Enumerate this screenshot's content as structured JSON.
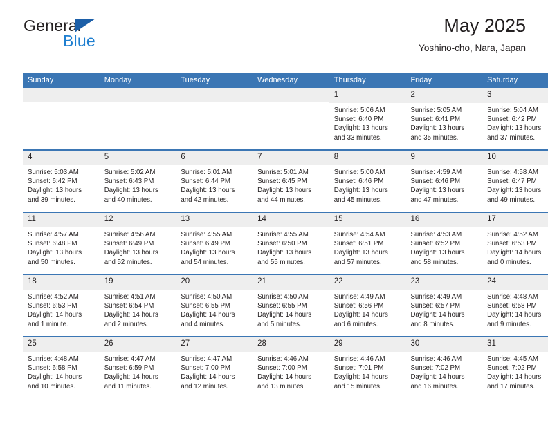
{
  "brand": {
    "name_part1": "General",
    "name_part2": "Blue",
    "flag_icon": "triangle-flag-icon"
  },
  "header": {
    "title": "May 2025",
    "location": "Yoshino-cho, Nara, Japan"
  },
  "colors": {
    "header_blue": "#3b76b4",
    "brand_blue": "#1f7fd0",
    "daynum_gray": "#eeeeee",
    "text": "#231f20"
  },
  "weekday_headers": [
    "Sunday",
    "Monday",
    "Tuesday",
    "Wednesday",
    "Thursday",
    "Friday",
    "Saturday"
  ],
  "labels": {
    "sunrise_prefix": "Sunrise:",
    "sunset_prefix": "Sunset:",
    "daylight_prefix": "Daylight:"
  },
  "weeks": [
    [
      {
        "day": "",
        "sunrise": "",
        "sunset": "",
        "daylight_line1": "",
        "daylight_line2": ""
      },
      {
        "day": "",
        "sunrise": "",
        "sunset": "",
        "daylight_line1": "",
        "daylight_line2": ""
      },
      {
        "day": "",
        "sunrise": "",
        "sunset": "",
        "daylight_line1": "",
        "daylight_line2": ""
      },
      {
        "day": "",
        "sunrise": "",
        "sunset": "",
        "daylight_line1": "",
        "daylight_line2": ""
      },
      {
        "day": "1",
        "sunrise": "Sunrise: 5:06 AM",
        "sunset": "Sunset: 6:40 PM",
        "daylight_line1": "Daylight: 13 hours",
        "daylight_line2": "and 33 minutes."
      },
      {
        "day": "2",
        "sunrise": "Sunrise: 5:05 AM",
        "sunset": "Sunset: 6:41 PM",
        "daylight_line1": "Daylight: 13 hours",
        "daylight_line2": "and 35 minutes."
      },
      {
        "day": "3",
        "sunrise": "Sunrise: 5:04 AM",
        "sunset": "Sunset: 6:42 PM",
        "daylight_line1": "Daylight: 13 hours",
        "daylight_line2": "and 37 minutes."
      }
    ],
    [
      {
        "day": "4",
        "sunrise": "Sunrise: 5:03 AM",
        "sunset": "Sunset: 6:42 PM",
        "daylight_line1": "Daylight: 13 hours",
        "daylight_line2": "and 39 minutes."
      },
      {
        "day": "5",
        "sunrise": "Sunrise: 5:02 AM",
        "sunset": "Sunset: 6:43 PM",
        "daylight_line1": "Daylight: 13 hours",
        "daylight_line2": "and 40 minutes."
      },
      {
        "day": "6",
        "sunrise": "Sunrise: 5:01 AM",
        "sunset": "Sunset: 6:44 PM",
        "daylight_line1": "Daylight: 13 hours",
        "daylight_line2": "and 42 minutes."
      },
      {
        "day": "7",
        "sunrise": "Sunrise: 5:01 AM",
        "sunset": "Sunset: 6:45 PM",
        "daylight_line1": "Daylight: 13 hours",
        "daylight_line2": "and 44 minutes."
      },
      {
        "day": "8",
        "sunrise": "Sunrise: 5:00 AM",
        "sunset": "Sunset: 6:46 PM",
        "daylight_line1": "Daylight: 13 hours",
        "daylight_line2": "and 45 minutes."
      },
      {
        "day": "9",
        "sunrise": "Sunrise: 4:59 AM",
        "sunset": "Sunset: 6:46 PM",
        "daylight_line1": "Daylight: 13 hours",
        "daylight_line2": "and 47 minutes."
      },
      {
        "day": "10",
        "sunrise": "Sunrise: 4:58 AM",
        "sunset": "Sunset: 6:47 PM",
        "daylight_line1": "Daylight: 13 hours",
        "daylight_line2": "and 49 minutes."
      }
    ],
    [
      {
        "day": "11",
        "sunrise": "Sunrise: 4:57 AM",
        "sunset": "Sunset: 6:48 PM",
        "daylight_line1": "Daylight: 13 hours",
        "daylight_line2": "and 50 minutes."
      },
      {
        "day": "12",
        "sunrise": "Sunrise: 4:56 AM",
        "sunset": "Sunset: 6:49 PM",
        "daylight_line1": "Daylight: 13 hours",
        "daylight_line2": "and 52 minutes."
      },
      {
        "day": "13",
        "sunrise": "Sunrise: 4:55 AM",
        "sunset": "Sunset: 6:49 PM",
        "daylight_line1": "Daylight: 13 hours",
        "daylight_line2": "and 54 minutes."
      },
      {
        "day": "14",
        "sunrise": "Sunrise: 4:55 AM",
        "sunset": "Sunset: 6:50 PM",
        "daylight_line1": "Daylight: 13 hours",
        "daylight_line2": "and 55 minutes."
      },
      {
        "day": "15",
        "sunrise": "Sunrise: 4:54 AM",
        "sunset": "Sunset: 6:51 PM",
        "daylight_line1": "Daylight: 13 hours",
        "daylight_line2": "and 57 minutes."
      },
      {
        "day": "16",
        "sunrise": "Sunrise: 4:53 AM",
        "sunset": "Sunset: 6:52 PM",
        "daylight_line1": "Daylight: 13 hours",
        "daylight_line2": "and 58 minutes."
      },
      {
        "day": "17",
        "sunrise": "Sunrise: 4:52 AM",
        "sunset": "Sunset: 6:53 PM",
        "daylight_line1": "Daylight: 14 hours",
        "daylight_line2": "and 0 minutes."
      }
    ],
    [
      {
        "day": "18",
        "sunrise": "Sunrise: 4:52 AM",
        "sunset": "Sunset: 6:53 PM",
        "daylight_line1": "Daylight: 14 hours",
        "daylight_line2": "and 1 minute."
      },
      {
        "day": "19",
        "sunrise": "Sunrise: 4:51 AM",
        "sunset": "Sunset: 6:54 PM",
        "daylight_line1": "Daylight: 14 hours",
        "daylight_line2": "and 2 minutes."
      },
      {
        "day": "20",
        "sunrise": "Sunrise: 4:50 AM",
        "sunset": "Sunset: 6:55 PM",
        "daylight_line1": "Daylight: 14 hours",
        "daylight_line2": "and 4 minutes."
      },
      {
        "day": "21",
        "sunrise": "Sunrise: 4:50 AM",
        "sunset": "Sunset: 6:55 PM",
        "daylight_line1": "Daylight: 14 hours",
        "daylight_line2": "and 5 minutes."
      },
      {
        "day": "22",
        "sunrise": "Sunrise: 4:49 AM",
        "sunset": "Sunset: 6:56 PM",
        "daylight_line1": "Daylight: 14 hours",
        "daylight_line2": "and 6 minutes."
      },
      {
        "day": "23",
        "sunrise": "Sunrise: 4:49 AM",
        "sunset": "Sunset: 6:57 PM",
        "daylight_line1": "Daylight: 14 hours",
        "daylight_line2": "and 8 minutes."
      },
      {
        "day": "24",
        "sunrise": "Sunrise: 4:48 AM",
        "sunset": "Sunset: 6:58 PM",
        "daylight_line1": "Daylight: 14 hours",
        "daylight_line2": "and 9 minutes."
      }
    ],
    [
      {
        "day": "25",
        "sunrise": "Sunrise: 4:48 AM",
        "sunset": "Sunset: 6:58 PM",
        "daylight_line1": "Daylight: 14 hours",
        "daylight_line2": "and 10 minutes."
      },
      {
        "day": "26",
        "sunrise": "Sunrise: 4:47 AM",
        "sunset": "Sunset: 6:59 PM",
        "daylight_line1": "Daylight: 14 hours",
        "daylight_line2": "and 11 minutes."
      },
      {
        "day": "27",
        "sunrise": "Sunrise: 4:47 AM",
        "sunset": "Sunset: 7:00 PM",
        "daylight_line1": "Daylight: 14 hours",
        "daylight_line2": "and 12 minutes."
      },
      {
        "day": "28",
        "sunrise": "Sunrise: 4:46 AM",
        "sunset": "Sunset: 7:00 PM",
        "daylight_line1": "Daylight: 14 hours",
        "daylight_line2": "and 13 minutes."
      },
      {
        "day": "29",
        "sunrise": "Sunrise: 4:46 AM",
        "sunset": "Sunset: 7:01 PM",
        "daylight_line1": "Daylight: 14 hours",
        "daylight_line2": "and 15 minutes."
      },
      {
        "day": "30",
        "sunrise": "Sunrise: 4:46 AM",
        "sunset": "Sunset: 7:02 PM",
        "daylight_line1": "Daylight: 14 hours",
        "daylight_line2": "and 16 minutes."
      },
      {
        "day": "31",
        "sunrise": "Sunrise: 4:45 AM",
        "sunset": "Sunset: 7:02 PM",
        "daylight_line1": "Daylight: 14 hours",
        "daylight_line2": "and 17 minutes."
      }
    ]
  ]
}
